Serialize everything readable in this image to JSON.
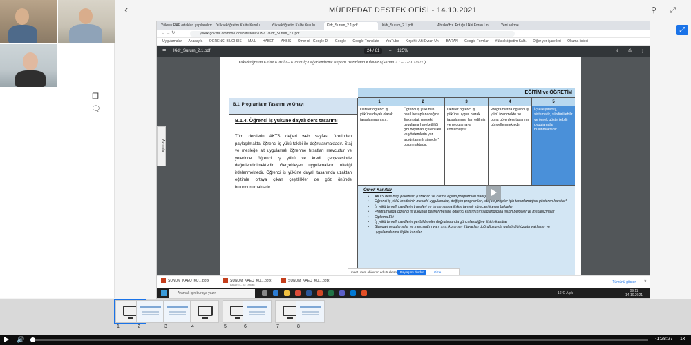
{
  "header": {
    "title": "MÜFREDAT DESTEK OFİSİ - 14.10.2021",
    "icons": [
      "search-icon",
      "expand-icon"
    ]
  },
  "left_panel": {
    "participants": [
      "participant-1",
      "participant-2",
      "participant-3"
    ],
    "tools": [
      "copy-icon",
      "chat-icon"
    ]
  },
  "browser": {
    "tabs": [
      "Yüksek RAP ortakları yapılandırma",
      "Yükseköğretim Kalite Kurulu",
      "Yükseköğretim Kalite Kurulu",
      "Kidr_Surum_2.1.pdf",
      "Kidr_Surum_2.1.pdf",
      "Ahıska/Hz. Ertuğrul Ahi Evran Ün.",
      "Yeni sekme"
    ],
    "url": "yokak.gov.tr/Common/Docs/Site/Kalavuz/2.1/Kidr_Surum_2.1.pdf",
    "bookmarks": [
      "Uygulamalar",
      "Anasayfa",
      "ÖĞRENCİ BİLGİ SİS",
      "MAİL",
      "HABER",
      "AKBİS",
      "Ömer ol - Google D.",
      "Google",
      "Google Translate",
      "YouTube",
      "Kırşehir Ahi Evran Ün.",
      "BARAN",
      "Google Formlar",
      "Yükseköğretim Kalit.",
      "Diğer yer işaretleri",
      "Okuma listesi"
    ],
    "pdf": {
      "filename": "Kidr_Surum_2.1.pdf",
      "page_current": "24",
      "page_total": "/ 81",
      "zoom": "125%",
      "aside_label": "Ayrıntılar",
      "page_header": "Yükseköğretim Kalite Kurulu – Kurum İç Değerlendirme Raporu Hazırlama Kılavuzu (Sürüm 2.1 – 27/01/2021 )",
      "band_title": "EĞİTİM ve ÖĞRETİM",
      "section_title": "B.1. Programların Tasarımı ve Onayı",
      "levels": [
        "1",
        "2",
        "3",
        "4",
        "5"
      ],
      "level_texts": [
        "Dersler öğrenci iş yüküne dayalı olarak tasarlanmamıştır.",
        "Öğrenci iş yükünün nasıl hesaplanacağına ilişkin staj, mesleki uygulama hareketliliği gibi boyutları içeren ilke ve yöntemlerin yer aldığı tanımlı süreçler* bulunmaktadır.",
        "Dersler öğrenci iş yüküne uygun olarak tasarlanmış, ilan edilmiş ve uygulamaya konulmuştur.",
        "Programlarda öğrenci iş yükü izlenmekte ve buna göre ders tasarımı güncellenmektedir.",
        "İçselleştirilmiş, sistematik, sürdürülebilir ve örnek gösterilebilir uygulamalar bulunmaktadır."
      ],
      "criterion_title": "B.1.4. Öğrenci iş yüküne dayalı ders tasarımı",
      "criterion_body": "Tüm derslerin AKTS değeri web sayfası üzerinden paylaşılmakta, öğrenci iş yükü takibi ile doğrulanmaktadır. Staj ve mesleğe ait uygulamalı öğrenme fırsatları mevcuttur ve yeterince öğrenci iş yükü ve kredi çerçevesinde değerlendirilmektedir. Gerçekleşen uygulamaların niteliği irdelenmektedir. Öğrenci iş yüküne dayalı tasarımda uzaktan eğitimle ortaya çıkan çeşitlilikler de göz önünde bulundurulmaktadır.",
      "evidence_title": "Örnek Kanıtlar",
      "evidence": [
        "AKTS ders bilgi paketleri* (Uzaktan ve karma eğitim programları dahil)",
        "Öğrenci iş yükü kredisinin mesleki uygulamalar, değişim programları, staj ve projeler için tanımlandığını gösteren kanıtlar*",
        "İş yükü temelli kredilerin transferi ve tanınmasına ilişkin tanımlı süreçleri içeren belgeler",
        "Programlarda öğrenci iş yükünün belirlenmesine öğrenci katılımının sağlandığına ilişkin belgeler ve mekanizmalar",
        "Diploma Eki",
        "İş yükü temelli kredilerin geribildirimler doğrultusunda güncellendiğine ilişkin kanıtlar",
        "Standart uygulamalar ve mevzuattın yanı sıra; kurumun ihtiyaçları doğrultusunda geliştirdiği özgün yaklaşım ve uygulamalarına ilişkin kanıtlar"
      ]
    },
    "share_banner": {
      "text": "meet.uzem.ahievran.edu.tr ekranınızı paylaşıyor.",
      "stop_label": "Paylaşımı durdur",
      "hide_label": "Gizle"
    },
    "downloads": [
      "SUNUM_KAEU_KU....pptx",
      "SUNUM_KAEU_KU....pptx",
      "SUNUM_KAEU_KU....pptx"
    ],
    "download_sub": "Başarılı – Aç Tarkan",
    "show_all": "Tümünü göster",
    "taskbar": {
      "search_placeholder": "Aramak için buraya yazın",
      "weather": "16°C  Açık",
      "time": "09:11",
      "date": "14.10.2021"
    }
  },
  "thumbnails": [
    {
      "num": "1",
      "kind": "monitor",
      "active": true
    },
    {
      "num": "2",
      "kind": "slide"
    },
    {
      "num": "3",
      "kind": "slide"
    },
    {
      "num": "4",
      "kind": "monitor"
    },
    {
      "num": "5",
      "kind": "monitor"
    },
    {
      "num": "6",
      "kind": "slide"
    },
    {
      "num": "7",
      "kind": "monitor"
    },
    {
      "num": "8",
      "kind": "slide"
    }
  ],
  "player": {
    "time_remaining": "-1:28:27",
    "speed": "1x",
    "progress_fraction": 0.0008
  },
  "colors": {
    "accent": "#1a73e8",
    "table_band": "#b8d8ef",
    "highlight_level": "#4a90d9",
    "evidence_bg": "#d3e6f4"
  }
}
